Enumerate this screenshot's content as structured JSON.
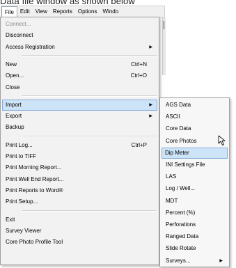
{
  "caption": "Data file window as shown below",
  "menubar": [
    {
      "label": "File",
      "active": true
    },
    {
      "label": "Edit"
    },
    {
      "label": "View"
    },
    {
      "label": "Reports"
    },
    {
      "label": "Options"
    },
    {
      "label": "Windo"
    }
  ],
  "file_menu": [
    {
      "label": "Connect...",
      "disabled": true
    },
    {
      "label": "Disconnect"
    },
    {
      "label": "Access Registration",
      "submenu": true
    },
    {
      "separator": true
    },
    {
      "label": "New",
      "shortcut": "Ctrl+N"
    },
    {
      "label": "Open...",
      "shortcut": "Ctrl+O"
    },
    {
      "label": "Close"
    },
    {
      "separator": true
    },
    {
      "label": "Import",
      "submenu": true,
      "highlighted": true
    },
    {
      "label": "Export",
      "submenu": true
    },
    {
      "label": "Backup"
    },
    {
      "separator": true
    },
    {
      "label": "Print Log...",
      "shortcut": "Ctrl+P"
    },
    {
      "label": "Print to TIFF"
    },
    {
      "label": "Print Morning Report..."
    },
    {
      "label": "Print Well End Report..."
    },
    {
      "label": "Print Reports to Word®"
    },
    {
      "label": "Print Setup..."
    },
    {
      "separator": true
    },
    {
      "label": "Exit"
    },
    {
      "label": "Survey Viewer"
    },
    {
      "label": "Core Photo Profile Tool"
    }
  ],
  "import_menu": [
    {
      "label": "AGS Data"
    },
    {
      "label": "ASCII"
    },
    {
      "label": "Core Data"
    },
    {
      "label": "Core Photos"
    },
    {
      "label": "Dip Meter",
      "highlighted": true
    },
    {
      "label": "INI Settings File"
    },
    {
      "label": "LAS"
    },
    {
      "label": "Log / Well..."
    },
    {
      "label": "MDT"
    },
    {
      "label": "Percent (%)"
    },
    {
      "label": "Perforations"
    },
    {
      "label": "Ranged Data"
    },
    {
      "label": "Slide Rotate"
    },
    {
      "label": "Surveys...",
      "submenu": true
    }
  ],
  "icons": {
    "submenu_arrow": "submenu-arrow-icon",
    "cursor": "mouse-pointer-icon"
  },
  "colors": {
    "highlight_fill": "#cde3f7",
    "highlight_border": "#84acd8",
    "menu_bg": "#f2f2f2",
    "disabled_text": "#8c8c8c"
  }
}
